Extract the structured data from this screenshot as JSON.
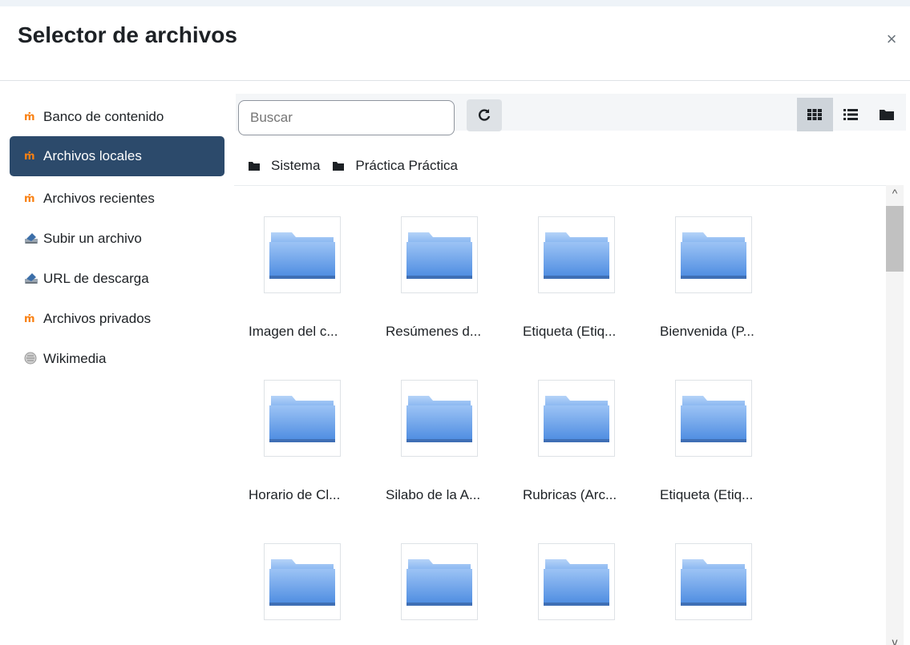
{
  "dialog": {
    "title": "Selector de archivos",
    "close_symbol": "×"
  },
  "repositories": [
    {
      "label": "Banco de contenido",
      "icon": "moodle-icon",
      "active": false
    },
    {
      "label": "Archivos locales",
      "icon": "moodle-icon",
      "active": true
    },
    {
      "label": "Archivos recientes",
      "icon": "moodle-icon",
      "active": false
    },
    {
      "label": "Subir un archivo",
      "icon": "upload-icon",
      "active": false
    },
    {
      "label": "URL de descarga",
      "icon": "url-icon",
      "active": false
    },
    {
      "label": "Archivos privados",
      "icon": "moodle-icon",
      "active": false
    },
    {
      "label": "Wikimedia",
      "icon": "wikimedia-icon",
      "active": false
    }
  ],
  "search": {
    "placeholder": "Buscar"
  },
  "breadcrumb": [
    "Sistema",
    "Práctica Práctica"
  ],
  "files": [
    "Imagen del c...",
    "Resúmenes d...",
    "Etiqueta (Etiq...",
    "Bienvenida (P...",
    "Horario de Cl...",
    "Silabo de la A...",
    "Rubricas (Arc...",
    "Etiqueta (Etiq...",
    "",
    "",
    "",
    ""
  ],
  "colors": {
    "active_repo": "#2c4a6b",
    "folder": "#6aa2ec"
  }
}
